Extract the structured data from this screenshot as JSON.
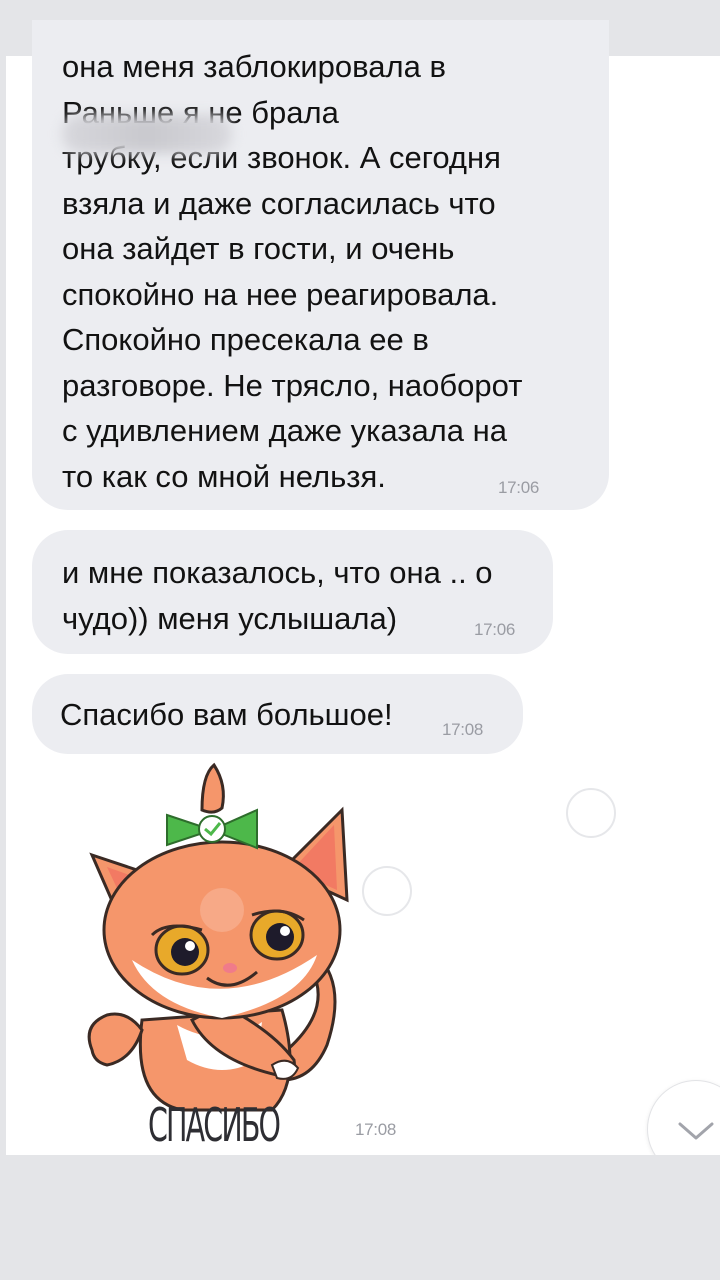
{
  "messages": [
    {
      "text": "она меня заблокировала в\n                Раньше я не брала\nтрубку, если звонок. А сегодня\nвзяла и даже согласилась что\nона зайдет в гости, и очень\nспокойно на нее реагировала.\nСпокойно пресекала ее в\nразговоре. Не трясло, наоборот\nс удивлением даже указала на\nто как со мной нельзя.",
      "time": "17:06"
    },
    {
      "text": "и мне показалось, что она .. о\nчудо)) меня услышала)",
      "time": "17:06"
    },
    {
      "text": "Спасибо вам большое!",
      "time": "17:08"
    }
  ],
  "sticker": {
    "caption": "СПАСИБО",
    "time": "17:08"
  },
  "colors": {
    "bubble": "#ecedf1",
    "background": "#e4e5e8",
    "cat_orange": "#f5966b",
    "bow_green": "#4db84a"
  },
  "icons": {
    "scroll_down": "chevron-down-icon"
  }
}
